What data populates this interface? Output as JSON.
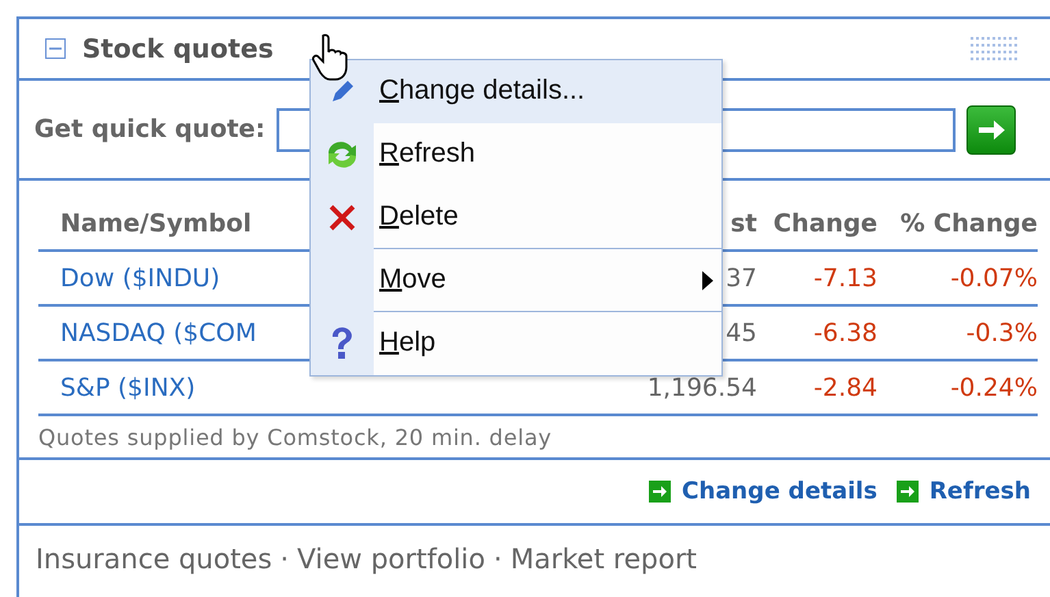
{
  "panel": {
    "title": "Stock quotes",
    "expanded": true
  },
  "quick_quote": {
    "label": "Get quick quote:"
  },
  "table": {
    "columns": [
      "Name/Symbol",
      "st",
      "Change",
      "% Change"
    ],
    "rows": [
      {
        "name": "Dow ($INDU)",
        "last": "37",
        "change": "-7.13",
        "percent": "-0.07%"
      },
      {
        "name": "NASDAQ ($COM",
        "last": "45",
        "change": "-6.38",
        "percent": "-0.3%"
      },
      {
        "name": "S&P ($INX)",
        "last": "1,196.54",
        "change": "-2.84",
        "percent": "-0.24%"
      }
    ]
  },
  "note": "Quotes supplied by Comstock, 20 min. delay",
  "actions": [
    "Change details",
    "Refresh"
  ],
  "footer_links": [
    "Insurance quotes",
    "View portfolio",
    "Market report"
  ],
  "footer_separator": "·",
  "context_menu": [
    {
      "kind": "edit",
      "label": "Change details...",
      "selected": true,
      "separator_after": false,
      "submenu": false
    },
    {
      "kind": "refresh",
      "label": "Refresh",
      "selected": false,
      "separator_after": false,
      "submenu": false
    },
    {
      "kind": "delete",
      "label": "Delete",
      "selected": false,
      "separator_after": true,
      "submenu": false
    },
    {
      "kind": "move",
      "label": "Move",
      "selected": false,
      "separator_after": true,
      "submenu": true
    },
    {
      "kind": "help",
      "label": "Help",
      "selected": false,
      "separator_after": false,
      "submenu": false
    }
  ]
}
